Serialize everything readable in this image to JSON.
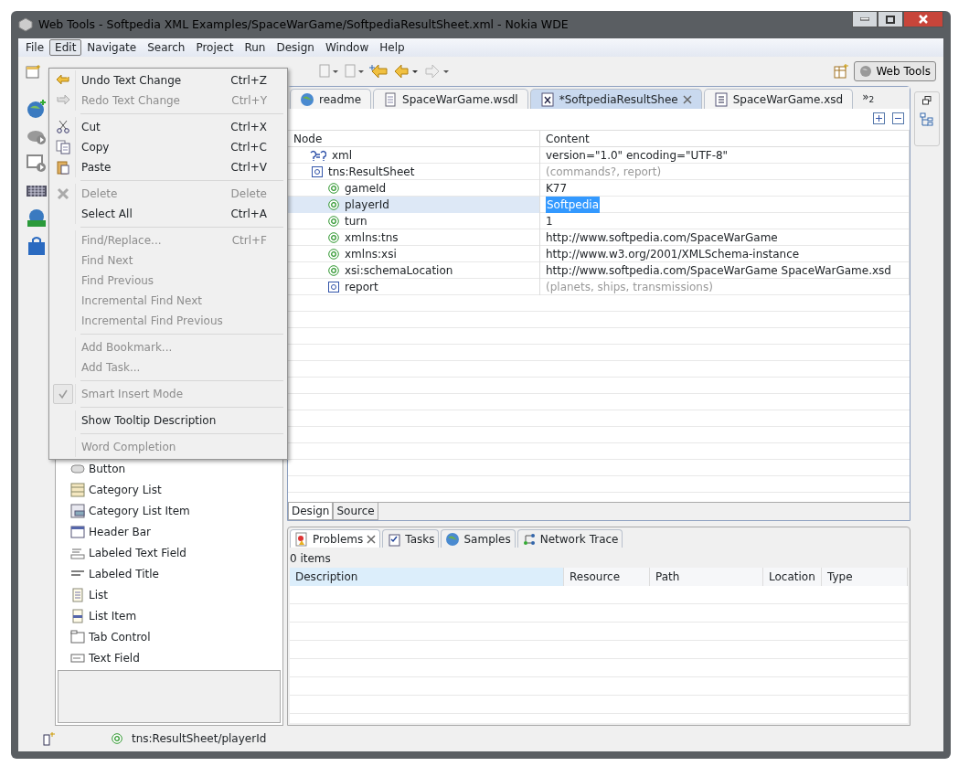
{
  "window": {
    "title": "Web Tools - Softpedia XML Examples/SpaceWarGame/SoftpediaResultSheet.xml - Nokia WDE"
  },
  "menu_bar": [
    {
      "label": "File",
      "selected": false
    },
    {
      "label": "Edit",
      "selected": true
    },
    {
      "label": "Navigate",
      "selected": false
    },
    {
      "label": "Search",
      "selected": false
    },
    {
      "label": "Project",
      "selected": false
    },
    {
      "label": "Run",
      "selected": false
    },
    {
      "label": "Design",
      "selected": false
    },
    {
      "label": "Window",
      "selected": false
    },
    {
      "label": "Help",
      "selected": false
    }
  ],
  "edit_menu": [
    {
      "kind": "item",
      "label": "Undo Text Change",
      "shortcut": "Ctrl+Z",
      "disabled": false
    },
    {
      "kind": "item",
      "label": "Redo Text Change",
      "shortcut": "Ctrl+Y",
      "disabled": true
    },
    {
      "kind": "separator"
    },
    {
      "kind": "item",
      "label": "Cut",
      "shortcut": "Ctrl+X",
      "disabled": false
    },
    {
      "kind": "item",
      "label": "Copy",
      "shortcut": "Ctrl+C",
      "disabled": false
    },
    {
      "kind": "item",
      "label": "Paste",
      "shortcut": "Ctrl+V",
      "disabled": false
    },
    {
      "kind": "separator"
    },
    {
      "kind": "item",
      "label": "Delete",
      "shortcut": "Delete",
      "disabled": true
    },
    {
      "kind": "item",
      "label": "Select All",
      "shortcut": "Ctrl+A",
      "disabled": false
    },
    {
      "kind": "separator"
    },
    {
      "kind": "item",
      "label": "Find/Replace...",
      "shortcut": "Ctrl+F",
      "disabled": true
    },
    {
      "kind": "item",
      "label": "Find Next",
      "disabled": true
    },
    {
      "kind": "item",
      "label": "Find Previous",
      "disabled": true
    },
    {
      "kind": "item",
      "label": "Incremental Find Next",
      "disabled": true
    },
    {
      "kind": "item",
      "label": "Incremental Find Previous",
      "disabled": true
    },
    {
      "kind": "separator"
    },
    {
      "kind": "item",
      "label": "Add Bookmark...",
      "disabled": true
    },
    {
      "kind": "item",
      "label": "Add Task...",
      "disabled": true
    },
    {
      "kind": "separator"
    },
    {
      "kind": "check",
      "label": "Smart Insert Mode",
      "disabled": true,
      "checked": true
    },
    {
      "kind": "separator"
    },
    {
      "kind": "item",
      "label": "Show Tooltip Description",
      "disabled": false
    },
    {
      "kind": "separator"
    },
    {
      "kind": "item",
      "label": "Word Completion",
      "disabled": true
    }
  ],
  "perspective_button": {
    "label": "Web Tools"
  },
  "palette": {
    "items": [
      {
        "label": "Button"
      },
      {
        "label": "Category List"
      },
      {
        "label": "Category List Item"
      },
      {
        "label": "Header Bar"
      },
      {
        "label": "Labeled Text Field"
      },
      {
        "label": "Labeled Title"
      },
      {
        "label": "List"
      },
      {
        "label": "List Item"
      },
      {
        "label": "Tab Control"
      },
      {
        "label": "Text Field"
      }
    ]
  },
  "editor_tabs": [
    {
      "label": "readme",
      "selected": false
    },
    {
      "label": "SpaceWarGame.wsdl",
      "selected": false
    },
    {
      "label": "*SoftpediaResultShee",
      "selected": true
    },
    {
      "label": "SpaceWarGame.xsd",
      "selected": false
    }
  ],
  "editor_tabs_overflow": "»$_{2}$",
  "xml_tree": {
    "columns": [
      "Node",
      "Content"
    ],
    "rows": [
      {
        "kind": "pi",
        "node": "xml",
        "content": "version=\"1.0\" encoding=\"UTF-8\"",
        "hint": false,
        "selected": false
      },
      {
        "kind": "element",
        "node": "tns:ResultSheet",
        "content": "(commands?, report)",
        "hint": true,
        "selected": false,
        "children": [
          {
            "kind": "attribute",
            "node": "gameId",
            "content": "K77",
            "hint": false,
            "selected": false
          },
          {
            "kind": "attribute",
            "node": "playerId",
            "content": "Softpedia",
            "hint": false,
            "selected": true
          },
          {
            "kind": "attribute",
            "node": "turn",
            "content": "1",
            "hint": false,
            "selected": false
          },
          {
            "kind": "attribute",
            "node": "xmlns:tns",
            "content": "http://www.softpedia.com/SpaceWarGame",
            "hint": false,
            "selected": false
          },
          {
            "kind": "attribute",
            "node": "xmlns:xsi",
            "content": "http://www.w3.org/2001/XMLSchema-instance",
            "hint": false,
            "selected": false
          },
          {
            "kind": "attribute",
            "node": "xsi:schemaLocation",
            "content": "http://www.softpedia.com/SpaceWarGame SpaceWarGame.xsd",
            "hint": false,
            "selected": false
          },
          {
            "kind": "element",
            "node": "report",
            "content": "(planets, ships, transmissions)",
            "hint": true,
            "selected": false
          }
        ]
      }
    ]
  },
  "editor_mode_tabs": [
    {
      "label": "Design",
      "selected": true
    },
    {
      "label": "Source",
      "selected": false
    }
  ],
  "bottom_tabs": [
    {
      "label": "Problems",
      "selected": true
    },
    {
      "label": "Tasks",
      "selected": false
    },
    {
      "label": "Samples",
      "selected": false
    },
    {
      "label": "Network Trace",
      "selected": false
    }
  ],
  "problems": {
    "summary": "0 items",
    "columns": [
      "Description",
      "Resource",
      "Path",
      "Location",
      "Type"
    ]
  },
  "status_bar": {
    "text": "tns:ResultSheet/playerId"
  }
}
